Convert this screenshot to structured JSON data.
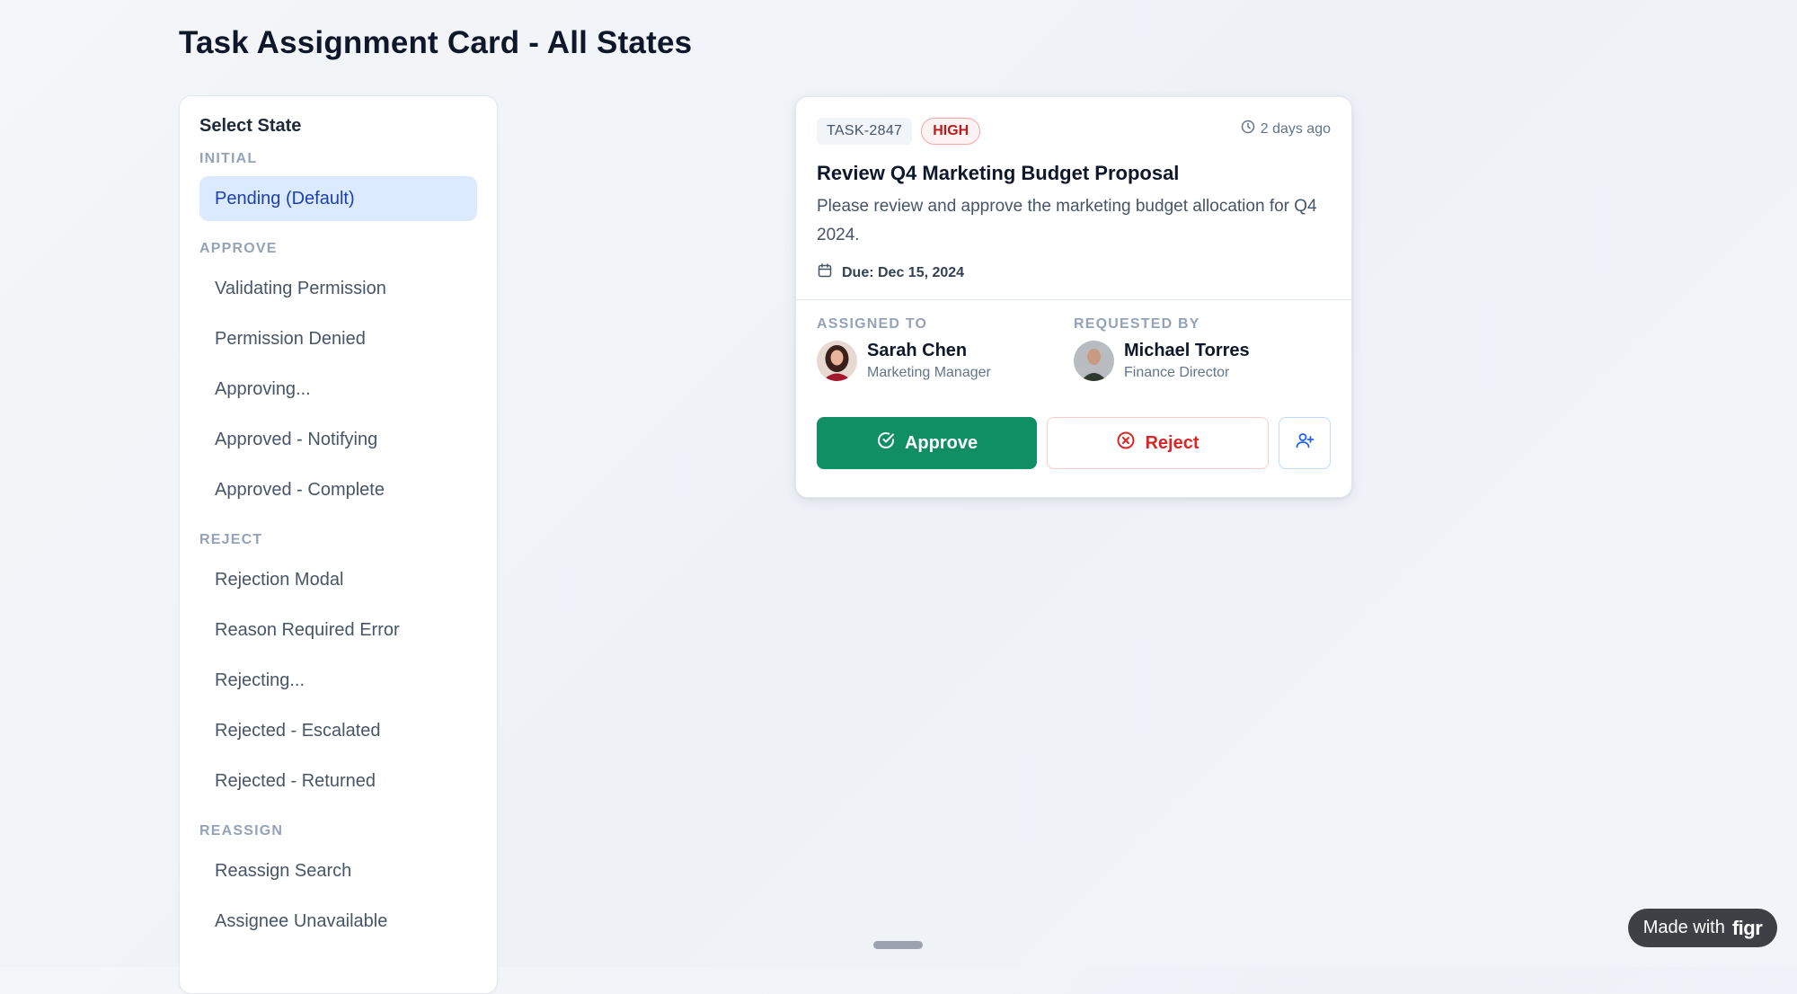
{
  "page_title": "Task Assignment Card - All States",
  "sidebar": {
    "heading": "Select State",
    "groups": [
      {
        "label": "INITIAL",
        "items": [
          {
            "label": "Pending (Default)",
            "active": true
          }
        ]
      },
      {
        "label": "APPROVE",
        "items": [
          {
            "label": "Validating Permission"
          },
          {
            "label": "Permission Denied"
          },
          {
            "label": "Approving..."
          },
          {
            "label": "Approved - Notifying"
          },
          {
            "label": "Approved - Complete"
          }
        ]
      },
      {
        "label": "REJECT",
        "items": [
          {
            "label": "Rejection Modal"
          },
          {
            "label": "Reason Required Error"
          },
          {
            "label": "Rejecting..."
          },
          {
            "label": "Rejected - Escalated"
          },
          {
            "label": "Rejected - Returned"
          }
        ]
      },
      {
        "label": "REASSIGN",
        "items": [
          {
            "label": "Reassign Search"
          },
          {
            "label": "Assignee Unavailable"
          }
        ]
      }
    ]
  },
  "card": {
    "task_id": "TASK-2847",
    "priority": "HIGH",
    "timestamp": "2 days ago",
    "title": "Review Q4 Marketing Budget Proposal",
    "description": "Please review and approve the marketing budget allocation for Q4 2024.",
    "due": "Due: Dec 15, 2024",
    "assigned_to": {
      "label": "ASSIGNED TO",
      "name": "Sarah Chen",
      "role": "Marketing Manager"
    },
    "requested_by": {
      "label": "REQUESTED BY",
      "name": "Michael Torres",
      "role": "Finance Director"
    },
    "actions": {
      "approve": "Approve",
      "reject": "Reject"
    }
  },
  "badge": {
    "prefix": "Made with",
    "brand": "figr"
  },
  "colors": {
    "accent": "#0f8f63",
    "danger": "#dc2626",
    "active_bg": "#dbeafe"
  }
}
